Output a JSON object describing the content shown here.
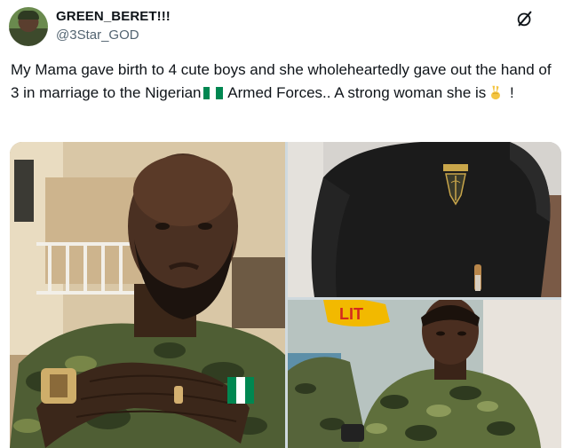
{
  "author": {
    "display_name": "GREEN_BERET!!!",
    "handle": "@3Star_GOD"
  },
  "icons": {
    "more": "grok-slash-icon",
    "flag": "nigeria-flag-emoji",
    "peace": "victory-hand-emoji"
  },
  "tweet": {
    "text_part1": "My Mama gave birth to 4 cute boys and she wholeheartedly gave out the hand of 3 in marriage to the Nigerian",
    "text_part2": " Armed Forces.. A strong woman she is",
    "text_part3": " !"
  },
  "colors": {
    "flag_green": "#008751",
    "text": "#0f1419",
    "secondary_text": "#536471"
  }
}
